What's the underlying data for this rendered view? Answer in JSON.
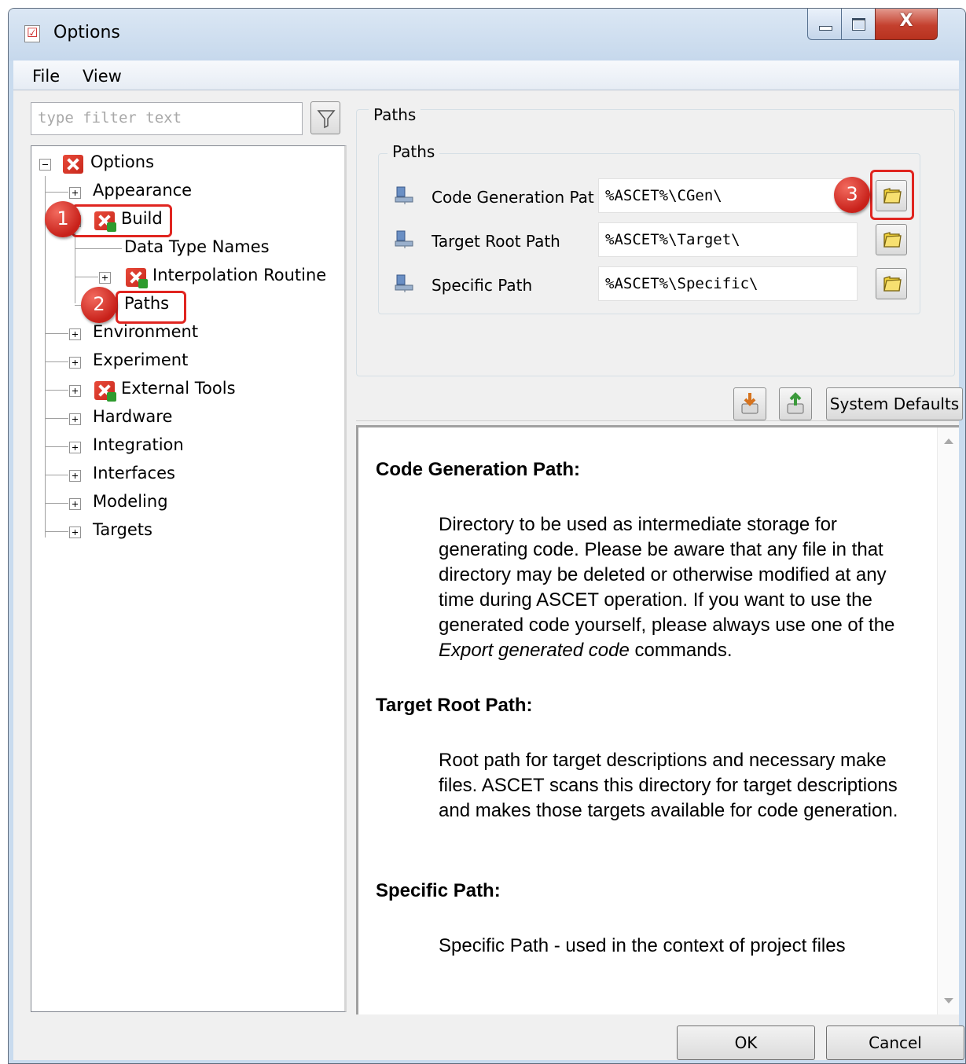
{
  "window": {
    "title": "Options",
    "controls": {
      "minimize": "minimize",
      "maximize": "maximize",
      "close": "X"
    }
  },
  "menu": [
    "File",
    "View"
  ],
  "filter": {
    "placeholder": "type filter text"
  },
  "tree": {
    "root": "Options",
    "items": {
      "appearance": "Appearance",
      "build": "Build",
      "data_type_names": "Data Type Names",
      "interpolation_routine": "Interpolation Routine",
      "paths": "Paths",
      "environment": "Environment",
      "experiment": "Experiment",
      "external_tools": "External Tools",
      "hardware": "Hardware",
      "integration": "Integration",
      "interfaces": "Interfaces",
      "modeling": "Modeling",
      "targets": "Targets"
    },
    "selected": "Paths"
  },
  "callouts": [
    "1",
    "2",
    "3"
  ],
  "paths_panel": {
    "outer_title": "Paths",
    "inner_title": "Paths",
    "rows": [
      {
        "label": "Code Generation Path",
        "value": "%ASCET%\\CGen\\"
      },
      {
        "label": "Target Root Path",
        "value": "%ASCET%\\Target\\"
      },
      {
        "label": "Specific Path",
        "value": "%ASCET%\\Specific\\"
      }
    ]
  },
  "buttons": {
    "system_defaults": "System Defaults",
    "ok": "OK",
    "cancel": "Cancel"
  },
  "help": {
    "sections": [
      {
        "heading": "Code Generation Path:",
        "body_before": "Directory to be used as intermediate storage for generating code. Please be aware that any file in that directory may be deleted or otherwise modified at any time during ASCET operation. If you want to use the generated code yourself, please always use one of the ",
        "body_italic": "Export generated code",
        "body_after": " commands."
      },
      {
        "heading": "Target Root Path:",
        "body": "Root path for target descriptions and necessary make files. ASCET scans this directory for target descriptions and makes those targets available for code generation."
      },
      {
        "heading": "Specific Path:",
        "body": "Specific Path - used in the context of project files"
      }
    ]
  },
  "colors": {
    "accent_red": "#e02520",
    "window_frame": "#c9dbee",
    "client_bg": "#f0f0f0"
  }
}
